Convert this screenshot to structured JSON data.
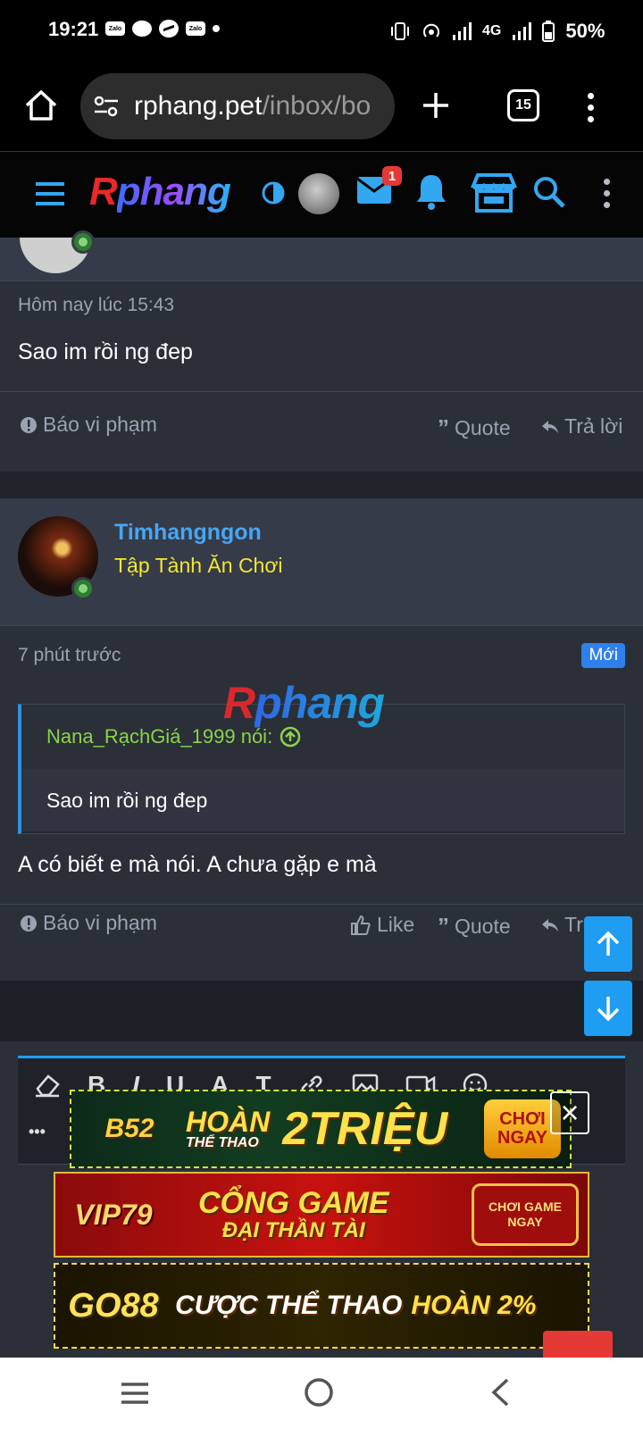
{
  "status_bar": {
    "time": "19:21",
    "app_icon_label": "Zalo",
    "network": "4G",
    "battery": "50%"
  },
  "browser": {
    "url_host": "rphang.pet",
    "url_path": "/inbox/bo",
    "tab_count": "15"
  },
  "site": {
    "logo_r": "R",
    "logo_rest": "phang",
    "notification_count": "1"
  },
  "posts": [
    {
      "time": "Hôm nay lúc 15:43",
      "body": "Sao im rồi ng đep",
      "actions": {
        "report": "Báo vi phạm",
        "quote": "Quote",
        "reply": "Trả lời"
      }
    },
    {
      "username": "Timhangngon",
      "user_title": "Tập Tành Ăn Chơi",
      "time": "7 phút trước",
      "new_badge": "Mới",
      "quote_author": "Nana_RạchGiá_1999 nói:",
      "quote_text": "Sao im rồi ng đep",
      "body": "A có biết e mà nói. A chưa gặp e mà",
      "actions": {
        "report": "Báo vi phạm",
        "like": "Like",
        "quote": "Quote",
        "reply": "Tr"
      }
    }
  ],
  "editor": {
    "toolbar": [
      "B",
      "I",
      "U",
      "A",
      "T"
    ],
    "more": "•••"
  },
  "ads": [
    {
      "brand": "B52",
      "line1": "HOÀN",
      "line2": "THỂ THAO",
      "headline": "2TRIỆU",
      "cta1": "CHƠI",
      "cta2": "NGAY"
    },
    {
      "brand": "VIP79",
      "line1": "CỔNG GAME",
      "line2": "ĐẠI THẦN TÀI",
      "cta1": "CHƠI GAME",
      "cta2": "NGAY"
    },
    {
      "brand": "GO88",
      "line1": "CƯỢC THỂ THAO",
      "headline": "HOÀN 2%"
    }
  ],
  "colors": {
    "accent": "#1e9df2",
    "username": "#46a6f5",
    "user_title": "#f5e830",
    "quote_author": "#8bd34a"
  }
}
